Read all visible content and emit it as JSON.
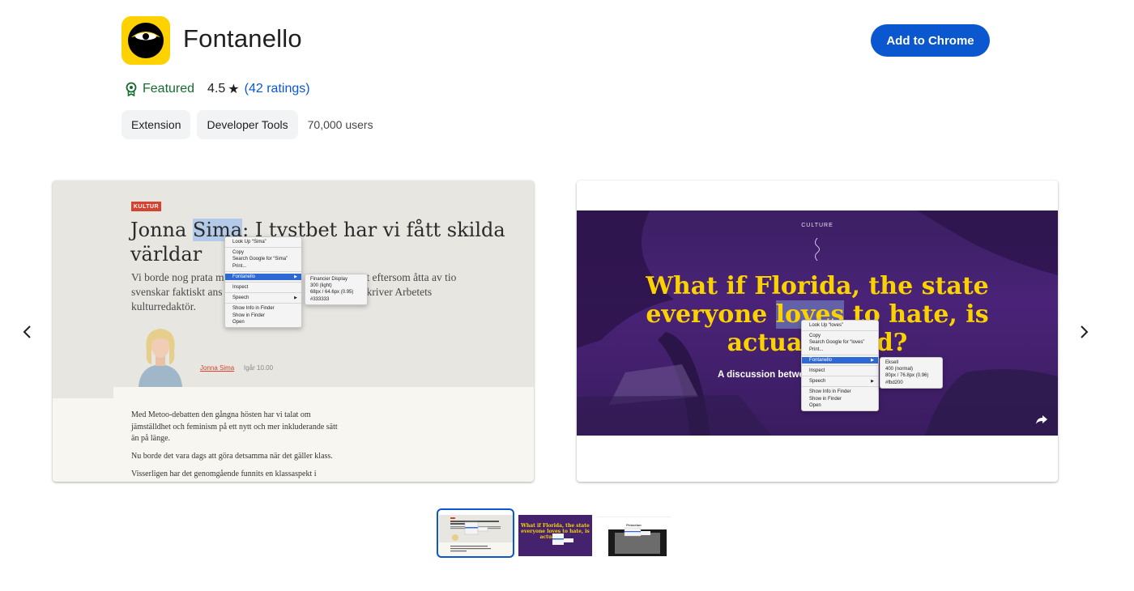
{
  "app": {
    "title": "Fontanello",
    "add_button": "Add to Chrome",
    "featured_label": "Featured",
    "rating": "4.5",
    "star": "★",
    "ratings_link": "(42 ratings)",
    "chips": [
      "Extension",
      "Developer Tools"
    ],
    "users": "70,000 users",
    "colors": {
      "accent": "#0b57d0",
      "featured": "#146c2e",
      "logo_bg": "#fdd200",
      "chip_bg": "#f1f3f4"
    }
  },
  "nav": {
    "prev_icon": "chevron-left-icon",
    "next_icon": "chevron-right-icon"
  },
  "shot1": {
    "tag": "KULTUR",
    "headline_1": "Jonna ",
    "headline_sel": "Sima",
    "headline_2": ": I tystbet har vi fått skilda",
    "headline_3": "världar",
    "lead_1": "Vi borde nog prata m",
    "lead_1b": "inst eftersom åtta av tio",
    "lead_2": "svenskar faktiskt ans",
    "lead_2b": "e, skriver Arbetets",
    "lead_3": "kulturredaktör.",
    "author": "Jonna Sima",
    "author_time": "Igår 10.00",
    "body_1": "Med Metoo-debatten den gångna hösten har vi talat om",
    "body_2": "jämställdhet och feminism på ett nytt och mer inkluderande sätt",
    "body_3": "än på länge.",
    "body_4": "Nu borde det vara dags att göra detsamma när det gäller klass.",
    "body_5": "Visserligen har det genomgående funnits en klassaspekt i",
    "menu": {
      "lookup": "Look Up “Sima”",
      "copy": "Copy",
      "search": "Search Google for “Sima”",
      "print": "Print...",
      "fontanello": "Fontanello",
      "inspect": "Inspect",
      "speech": "Speech",
      "show_info": "Show Info in Finder",
      "show_finder": "Show in Finder",
      "open": "Open"
    },
    "submenu": [
      "Financier Display",
      "300 (light)",
      "68px / 64.6px (0.95)",
      "#333333"
    ]
  },
  "shot2": {
    "culture": "CULTURE",
    "headline_1": "What if Florida, the state",
    "headline_2a": "everyone ",
    "headline_sel": "loves",
    "headline_2b": " to hate, is",
    "headline_3": "actual",
    "headline_3b": "d?",
    "sub": "A discussion betwe",
    "menu": {
      "lookup": "Look Up “loves”",
      "copy": "Copy",
      "search": "Search Google for “loves”",
      "print": "Print...",
      "fontanello": "Fontanello",
      "inspect": "Inspect",
      "speech": "Speech",
      "show_info": "Show Info in Finder",
      "show_finder": "Show in Finder",
      "open": "Open"
    },
    "submenu": [
      "Eksell",
      "400 (normal)",
      "80px / 76.8px (0.96)",
      "#fbd200"
    ]
  },
  "thumbs": {
    "t2_line1": "What if Florida, the state",
    "t2_line2": "everyone loves to hate, is",
    "t2_line3": "actual",
    "t3_title": "Princeton"
  }
}
